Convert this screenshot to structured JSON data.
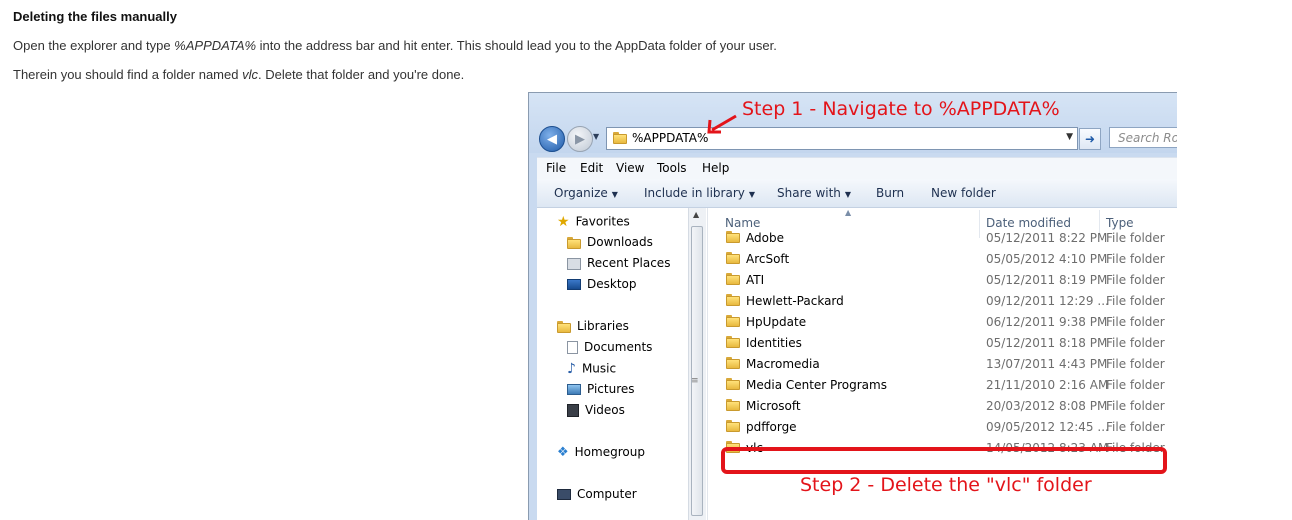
{
  "article": {
    "heading": "Deleting the files manually",
    "para1": {
      "before": "Open the explorer and type ",
      "em": "%APPDATA%",
      "after": " into the address bar and hit enter. This should lead you to the AppData folder of your user."
    },
    "para2": {
      "before": "Therein you should find a folder named ",
      "em": "vlc",
      "after": ". Delete that folder and you're done."
    }
  },
  "annotations": {
    "step1": "Step 1 - Navigate to %APPDATA%",
    "step2": "Step 2 - Delete the \"vlc\" folder",
    "color": "#e3141a"
  },
  "explorer": {
    "address": "%APPDATA%",
    "search_placeholder": "Search Roa",
    "menu": [
      "File",
      "Edit",
      "View",
      "Tools",
      "Help"
    ],
    "commands": [
      "Organize",
      "Include in library",
      "Share with",
      "Burn",
      "New folder"
    ],
    "nav": {
      "favorites": "Favorites",
      "downloads": "Downloads",
      "recent": "Recent Places",
      "desktop": "Desktop",
      "libraries": "Libraries",
      "documents": "Documents",
      "music": "Music",
      "pictures": "Pictures",
      "videos": "Videos",
      "homegroup": "Homegroup",
      "computer": "Computer"
    },
    "columns": {
      "name": "Name",
      "date": "Date modified",
      "type": "Type"
    },
    "rows": [
      {
        "name": "Adobe",
        "date": "05/12/2011 8:22 PM",
        "type": "File folder"
      },
      {
        "name": "ArcSoft",
        "date": "05/05/2012 4:10 PM",
        "type": "File folder"
      },
      {
        "name": "ATI",
        "date": "05/12/2011 8:19 PM",
        "type": "File folder"
      },
      {
        "name": "Hewlett-Packard",
        "date": "09/12/2011 12:29 ...",
        "type": "File folder"
      },
      {
        "name": "HpUpdate",
        "date": "06/12/2011 9:38 PM",
        "type": "File folder"
      },
      {
        "name": "Identities",
        "date": "05/12/2011 8:18 PM",
        "type": "File folder"
      },
      {
        "name": "Macromedia",
        "date": "13/07/2011 4:43 PM",
        "type": "File folder"
      },
      {
        "name": "Media Center Programs",
        "date": "21/11/2010 2:16 AM",
        "type": "File folder"
      },
      {
        "name": "Microsoft",
        "date": "20/03/2012 8:08 PM",
        "type": "File folder"
      },
      {
        "name": "pdfforge",
        "date": "09/05/2012 12:45 ...",
        "type": "File folder"
      },
      {
        "name": "vlc",
        "date": "14/05/2012 8:23 AM",
        "type": "File folder"
      }
    ]
  }
}
